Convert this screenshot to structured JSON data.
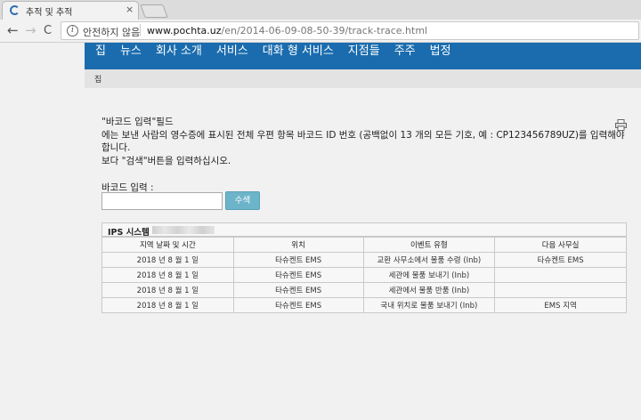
{
  "browser": {
    "tab_title": "추적 및 추적",
    "tab_close": "×",
    "security_label": "안전하지 않음",
    "url_host": "www.pochta.uz",
    "url_path": "/en/2014-06-09-08-50-39/track-trace.html",
    "back_glyph": "←",
    "forward_glyph": "→",
    "reload_glyph": "C",
    "info_glyph": "i"
  },
  "topnav": {
    "items": [
      "집",
      "뉴스",
      "회사 소개",
      "서비스",
      "대화 형 서비스",
      "지점들",
      "주주",
      "법정"
    ]
  },
  "breadcrumb": "집",
  "intro": {
    "line1": "\"바코드 입력\"필드",
    "line2": "에는 보낸 사람의 영수증에 표시된 전체 우편 항목 바코드 ID 번호 (공백없이 13 개의 모든 기호, 예 : CP123456789UZ)를 입력해야합니다.",
    "line3": "보다 \"검색\"버튼을 입력하십시오."
  },
  "form": {
    "barcode_label": "바코드 입력 :",
    "barcode_value": "",
    "search_label": "수색"
  },
  "table": {
    "title": "IPS 시스템",
    "headers": [
      "지역 날짜 및 시간",
      "위치",
      "이벤트 유형",
      "다음 사무실"
    ],
    "rows": [
      [
        "2018 년 8 월 1 일",
        "타슈켄트 EMS",
        "교환 사무소에서 물품 수령 (Inb)",
        "타슈켄트 EMS"
      ],
      [
        "2018 년 8 월 1 일",
        "타슈켄트 EMS",
        "세관에 물품 보내기 (Inb)",
        ""
      ],
      [
        "2018 년 8 월 1 일",
        "타슈켄트 EMS",
        "세관에서 물품 반품 (Inb)",
        ""
      ],
      [
        "2018 년 8 월 1 일",
        "타슈켄트 EMS",
        "국내 위치로 물품 보내기 (Inb)",
        "EMS 지역"
      ]
    ]
  },
  "icons": {
    "favicon": "loading-spinner-icon",
    "print": "printer-icon"
  },
  "colors": {
    "nav_blue": "#1a6cae",
    "search_button": "#6cb4c9"
  }
}
